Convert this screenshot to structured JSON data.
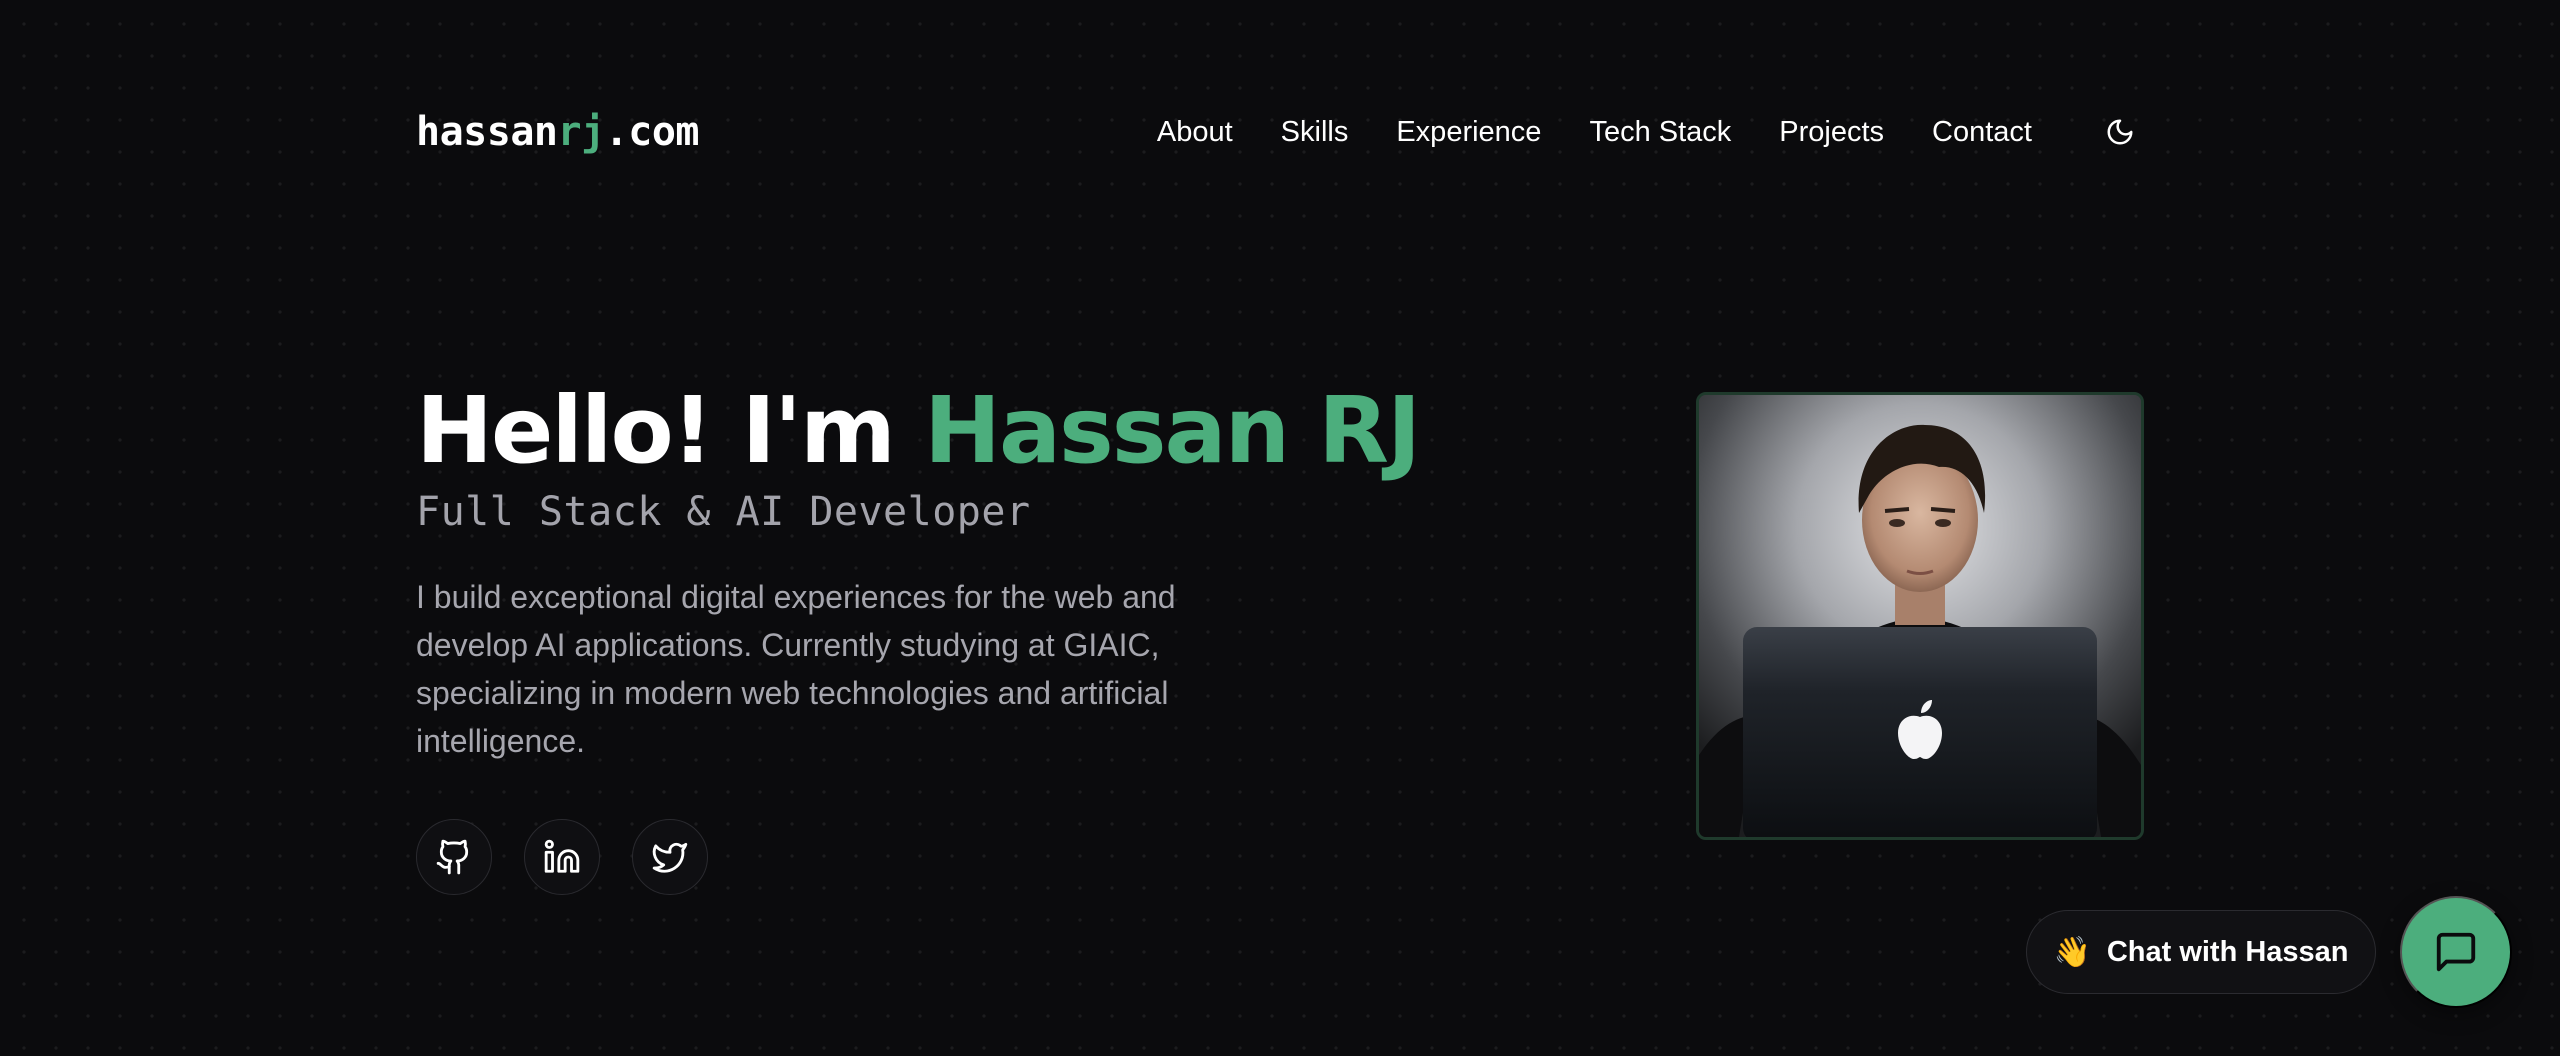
{
  "header": {
    "logo_prefix": "hassan",
    "logo_accent": "rj",
    "logo_suffix": ".com",
    "nav": [
      {
        "label": "About"
      },
      {
        "label": "Skills"
      },
      {
        "label": "Experience"
      },
      {
        "label": "Tech Stack"
      },
      {
        "label": "Projects"
      },
      {
        "label": "Contact"
      }
    ],
    "theme_icon": "moon-icon"
  },
  "hero": {
    "greeting": "Hello! I'm ",
    "name": "Hassan RJ",
    "subtitle": "Full Stack & AI Developer",
    "description": "I build exceptional digital experiences for the web and develop AI applications. Currently studying at GIAIC, specializing in modern web technologies and artificial intelligence.",
    "socials": [
      {
        "icon": "github-icon"
      },
      {
        "icon": "linkedin-icon"
      },
      {
        "icon": "twitter-icon"
      }
    ]
  },
  "chat": {
    "emoji": "👋",
    "label": "Chat with Hassan",
    "fab_icon": "chat-bubble-icon"
  },
  "colors": {
    "accent": "#4cae7d",
    "background": "#0b0b0d",
    "muted_text": "#a6a6ae"
  }
}
